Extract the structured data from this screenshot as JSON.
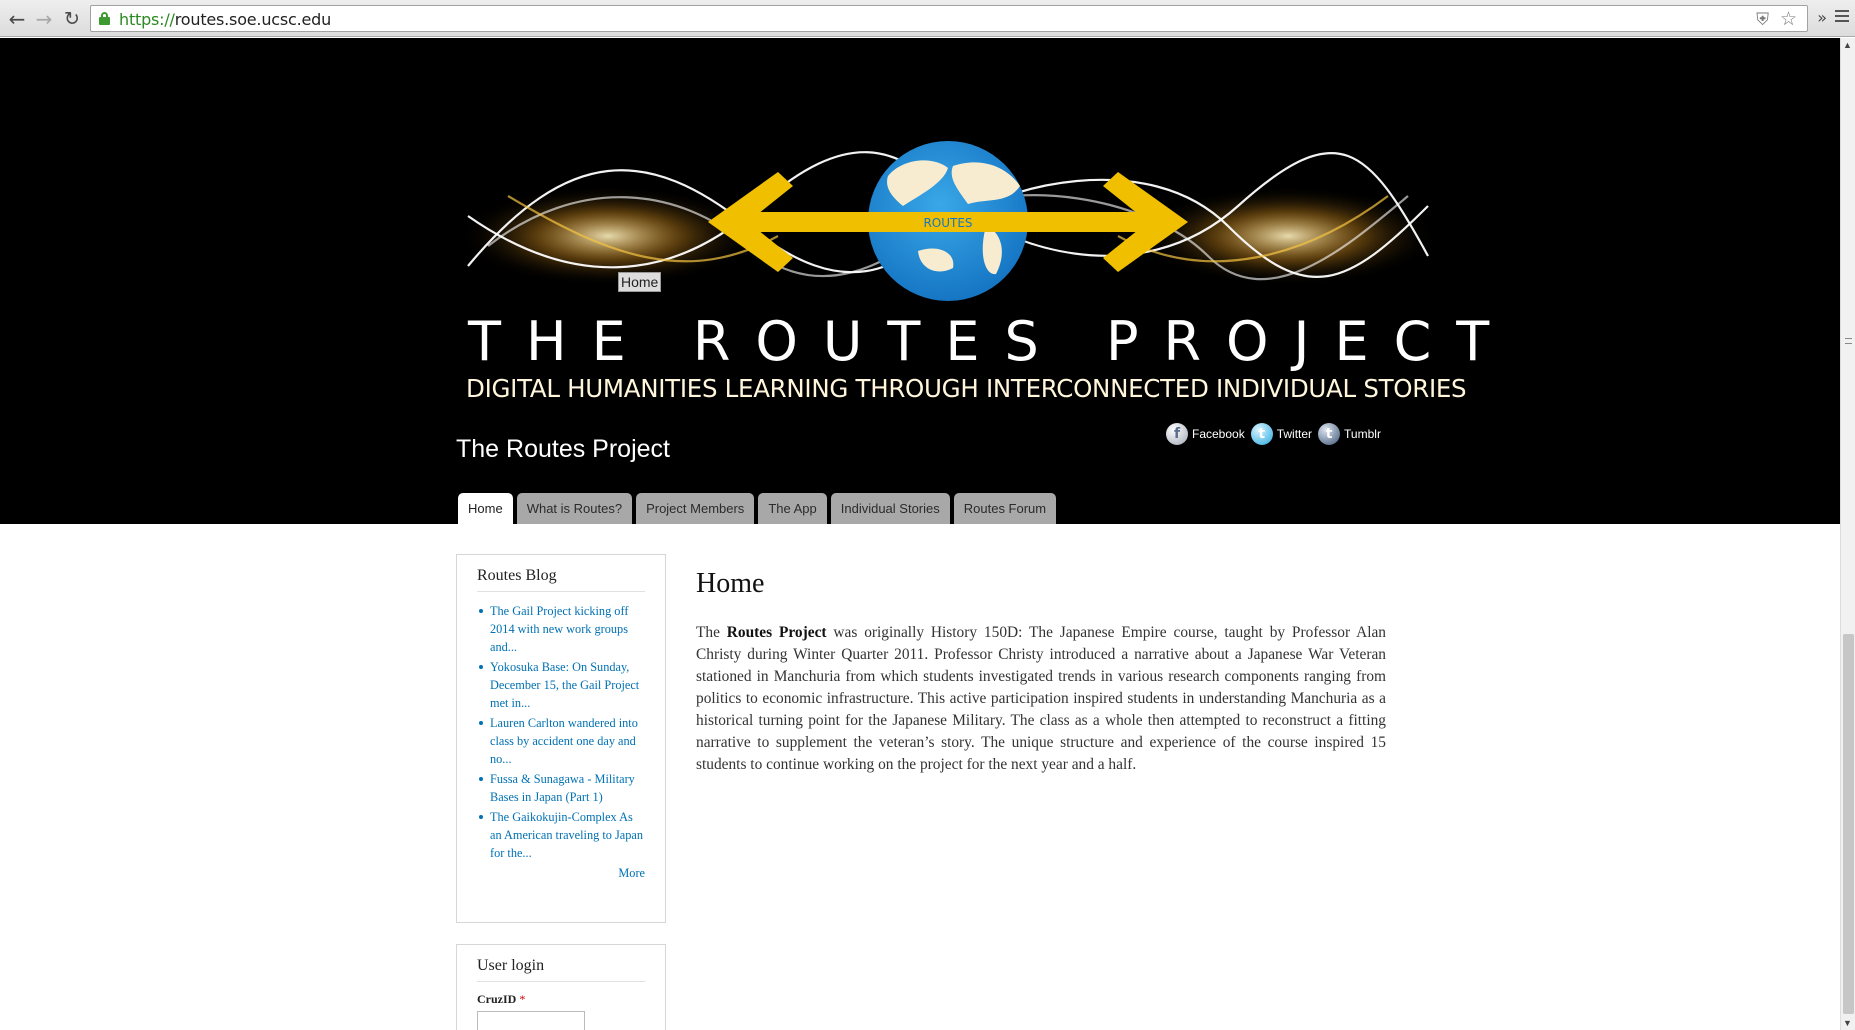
{
  "browser": {
    "url_protocol": "https://",
    "url_host": "routes.soe.ucsc.edu",
    "back_icon": "arrow-left-icon",
    "forward_icon": "arrow-right-icon",
    "reload_icon": "reload-icon",
    "extensions_label": "»"
  },
  "header": {
    "logo_badge": "ROUTES",
    "logo_title": "THE ROUTES PROJECT",
    "logo_subtitle": "DIGITAL HUMANITIES LEARNING THROUGH INTERCONNECTED INDIVIDUAL STORIES",
    "tooltip": "Home",
    "site_name": "The Routes Project",
    "social": [
      {
        "label": "Facebook",
        "icon": "f"
      },
      {
        "label": "Twitter",
        "icon": "t"
      },
      {
        "label": "Tumblr",
        "icon": "t"
      }
    ]
  },
  "tabs": [
    {
      "label": "Home",
      "active": true
    },
    {
      "label": "What is Routes?"
    },
    {
      "label": "Project Members"
    },
    {
      "label": "The App"
    },
    {
      "label": "Individual Stories"
    },
    {
      "label": "Routes Forum"
    }
  ],
  "sidebar": {
    "blog": {
      "title": "Routes Blog",
      "items": [
        "The Gail Project kicking off 2014 with new work groups and...",
        "Yokosuka Base: On Sunday, December 15, the Gail Project met in...",
        "Lauren Carlton wandered into class by accident one day and no...",
        "Fussa & Sunagawa - Military Bases in Japan (Part 1)",
        "The Gaikokujin-Complex As an American traveling to Japan for the..."
      ],
      "more": "More"
    },
    "login": {
      "title": "User login",
      "field_label": "CruzID",
      "required_mark": "*"
    }
  },
  "main": {
    "title": "Home",
    "body_lead": "The ",
    "body_bold": "Routes Project",
    "body_rest": " was originally History 150D: The Japanese Empire course, taught by Professor Alan Christy during Winter Quarter 2011. Professor Christy introduced a narrative about a Japanese War Veteran stationed in Manchuria from which students investigated trends in various research components ranging from politics to economic infrastructure.  This active participation inspired students in understanding Manchuria as a historical turning point for the Japanese Military. The class as a whole then attempted to reconstruct a fitting narrative to supplement the veteran’s story. The unique structure and experience of the course inspired 15 students to continue working on the project for the next year and a half."
  }
}
